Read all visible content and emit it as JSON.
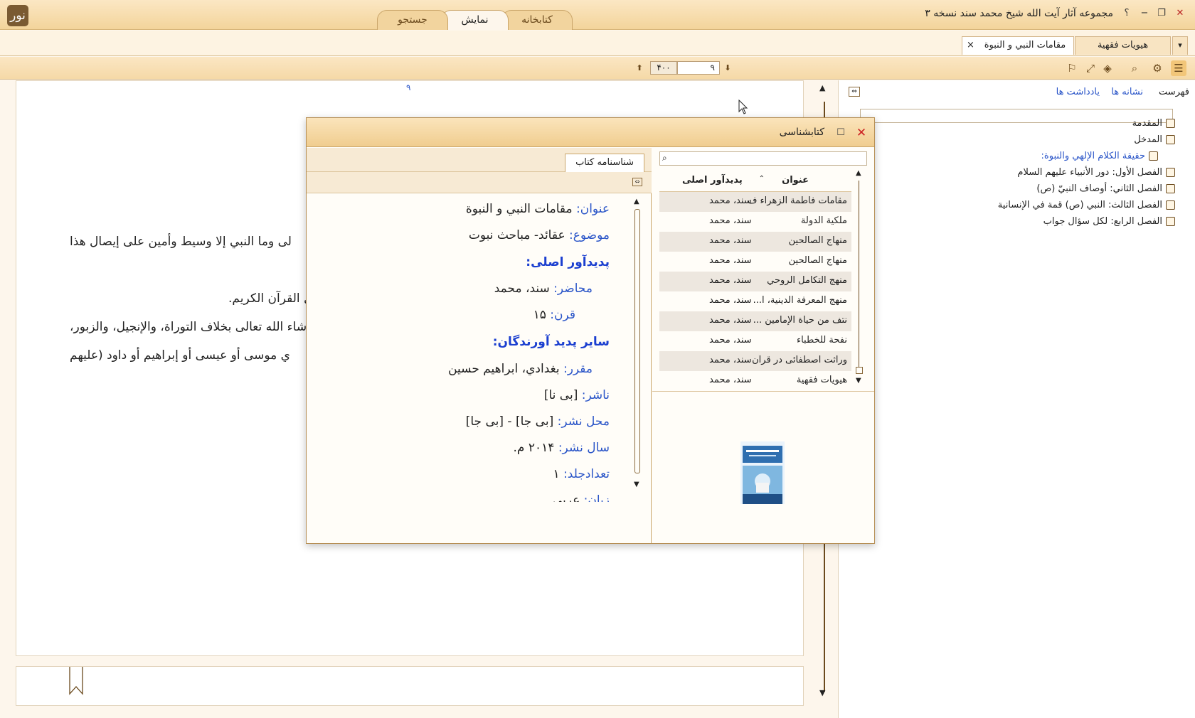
{
  "app": {
    "title": "مجموعه آثار آیت الله شیخ محمد سند نسخه ۳",
    "logo": "نور",
    "buttons": {
      "help": "؟",
      "minimize": "−",
      "restore": "❐",
      "close": "✕"
    }
  },
  "main_tabs": [
    {
      "label": "کتابخانه"
    },
    {
      "label": "نمایش"
    },
    {
      "label": "جستجو"
    }
  ],
  "doc_tabs": [
    {
      "label": "هیویات فقهیة"
    },
    {
      "label": "مقامات النبي و النبوة",
      "close": "×"
    }
  ],
  "toolbar": {
    "page_current": "۹",
    "page_total": "۴۰۰",
    "icons": [
      "list-icon",
      "gear-icon",
      "search-icon",
      "layers-icon",
      "fullscreen-icon",
      "bookmark-icon"
    ]
  },
  "content": {
    "page_number": "۹",
    "lines": [
      "لى وما النبي إلا وسيط وأمين على إيصال هذا",
      "ل القرآن الكريم.",
      "شاء الله تعالى بخلاف التوراة، والإنجيل، والزبور،",
      "ي موسى أو عيسى أو إبراهيم أو داود (عليهم"
    ]
  },
  "right_panel": {
    "tabs": [
      "فهرست",
      "نشانه ها",
      "یادداشت ها"
    ],
    "toc": [
      {
        "label": "المقدمة"
      },
      {
        "label": "المدخل"
      },
      {
        "label": "حقيقة الكلام الإلهي والنبوة:"
      },
      {
        "label": "الفصل الأول: دور الأنبياء عليهم السلام"
      },
      {
        "label": "الفصل الثاني: أوصاف النبيّ (ص)"
      },
      {
        "label": "الفصل الثالث: النبي (ص) قمة في الإنسانية"
      },
      {
        "label": "الفصل الرابع: لكل سؤال جواب"
      }
    ]
  },
  "dialog": {
    "title": "کتابشناسی",
    "tab": "شناسنامه کتاب",
    "details": {
      "title_label": "عنوان:",
      "title_value": "مقامات النبي و النبوة",
      "subject_label": "موضوع:",
      "subject_value": "عقائد- مباحث نبوت",
      "creator_heading": "پدیدآور اصلی:",
      "lecturer_label": "محاضر:",
      "lecturer_value": "سند، محمد",
      "century_label": "قرن:",
      "century_value": "۱۵",
      "others_heading": "سایر پدید آورندگان:",
      "reporter_label": "مقرر:",
      "reporter_value": "بغدادي، ابراهيم حسين",
      "publisher_label": "ناشر:",
      "publisher_value": "[بی نا]",
      "place_label": "محل نشر:",
      "place_value": "[بی جا] - [بی جا]",
      "year_label": "سال نشر:",
      "year_value": "۲۰۱۴ م.",
      "volumes_label": "تعدادجلد:",
      "volumes_value": "۱",
      "lang_label": "زبان:",
      "lang_value": "عربی"
    },
    "books_header": {
      "title": "عنوان",
      "author": "پدیدآور اصلی"
    },
    "books": [
      {
        "title": "مقامات فاطمة الزهراء ف...",
        "author": "سند، محمد"
      },
      {
        "title": "ملكية الدولة",
        "author": "سند، محمد"
      },
      {
        "title": "منهاج الصالحين",
        "author": "سند، محمد"
      },
      {
        "title": "منهاج الصالحين",
        "author": "سند، محمد"
      },
      {
        "title": "منهج التكامل الروحي",
        "author": "سند، محمد"
      },
      {
        "title": "منهج المعرفة الدينية، ا...",
        "author": "سند، محمد"
      },
      {
        "title": "نتف من حياة الإمامين ...",
        "author": "سند، محمد"
      },
      {
        "title": "نفحة للخطباء",
        "author": "سند، محمد"
      },
      {
        "title": "وراثت اصطفائی در قرآن",
        "author": "سند، محمد"
      },
      {
        "title": "هيويات فقهية",
        "author": "سند، محمد"
      }
    ]
  }
}
